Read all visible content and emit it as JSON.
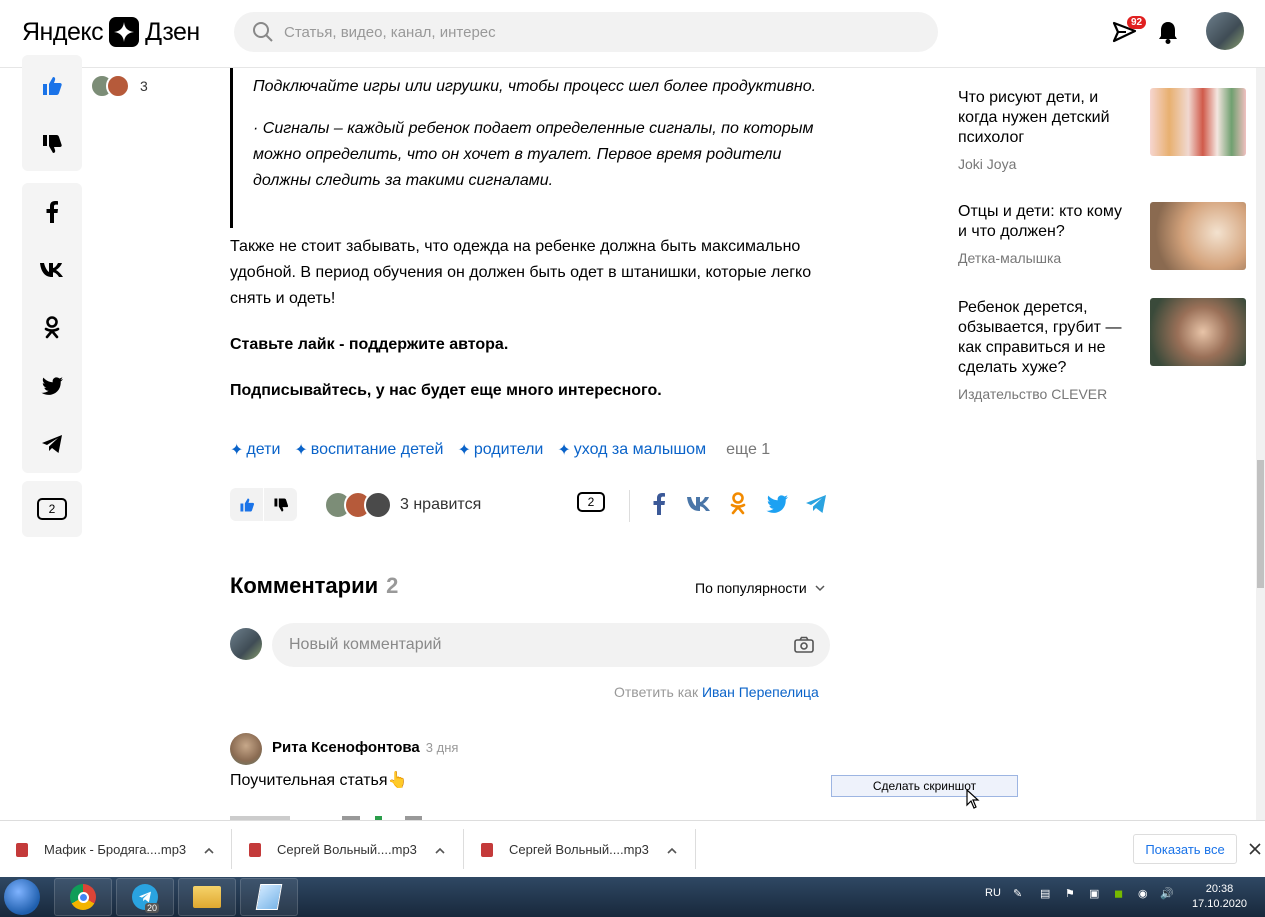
{
  "header": {
    "logo_left": "Яндекс",
    "logo_right": "Дзен",
    "search_placeholder": "Статья, видео, канал, интерес",
    "notif_badge": "92"
  },
  "left_bar": {
    "like_count": "3",
    "comments_count": "2"
  },
  "article": {
    "quote_para1": "Подключайте игры или игрушки, чтобы процесс шел более продуктивно.",
    "quote_para2": "· Сигналы – каждый ребенок подает определенные сигналы, по которым можно определить, что он хочет в туалет. Первое время родители должны следить за такими сигналами.",
    "para1": "Также не стоит забывать, что одежда на ребенке должна быть максимально удобной. В период обучения он должен быть одет в штанишки, которые легко снять и одеть!",
    "para2": "Ставьте лайк - поддержите автора.",
    "para3": "Подписывайтесь, у нас будет еще много интересного.",
    "tags": [
      "дети",
      "воспитание детей",
      "родители",
      "уход за малышом"
    ],
    "tags_more": "еще 1",
    "likes_text": "3 нравится",
    "comments_count": "2"
  },
  "comments": {
    "title": "Комментарии",
    "count": "2",
    "sort_label": "По популярности",
    "new_placeholder": "Новый комментарий",
    "reply_as_prefix": "Ответить как",
    "reply_as_name": "Иван Перепелица",
    "first": {
      "author": "Рита Ксенофонтова",
      "date": "3 дня",
      "text": "Поучительная статья👆"
    }
  },
  "sidebar": {
    "cards": [
      {
        "title": "Что рисуют дети, и когда нужен детский психолог",
        "source": "Joki Joya"
      },
      {
        "title": "Отцы и дети: кто кому и что должен?",
        "source": "Детка-малышка"
      },
      {
        "title": "Ребенок дерется, обзывается, грубит — как справиться и не сделать хуже?",
        "source": "Издательство CLEVER"
      }
    ]
  },
  "screenshot_button": "Сделать скриншот",
  "downloads": {
    "items": [
      "Мафик - Бродяга....mp3",
      "Сергей Вольный....mp3",
      "Сергей Вольный....mp3"
    ],
    "show_all": "Показать все"
  },
  "taskbar": {
    "lang": "RU",
    "time": "20:38",
    "date": "17.10.2020",
    "telegram_badge": "20"
  },
  "colors": {
    "link": "#0a63c9",
    "like_active": "#1a73e8",
    "badge": "#e02020",
    "ok_orange": "#f28a00",
    "fb_blue": "#3b5998",
    "vk_blue": "#4a76a8",
    "tw_blue": "#1da1f2"
  }
}
